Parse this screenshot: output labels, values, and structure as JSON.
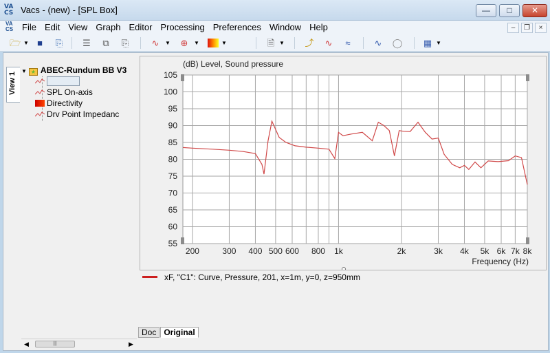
{
  "window": {
    "title": "Vacs - (new) - [SPL Box]",
    "app_icon": [
      "VA",
      "CS"
    ],
    "controls": [
      "minimize",
      "maximize",
      "close"
    ]
  },
  "menubar": {
    "items": [
      "File",
      "Edit",
      "View",
      "Graph",
      "Editor",
      "Processing",
      "Preferences",
      "Window",
      "Help"
    ],
    "mdi_controls": [
      "minimize",
      "restore",
      "close"
    ]
  },
  "toolbar": {
    "icons": [
      "open-folder-icon",
      "save-icon",
      "print-icon",
      "tree-icon",
      "copy-doc-icon",
      "paste-doc-icon",
      "curve-icon",
      "target-icon",
      "colormap-icon",
      "new-doc-icon",
      "load-icon",
      "plot-add-icon",
      "plot-multi-icon",
      "graph-export-icon",
      "disc-icon",
      "calendar-grid-icon"
    ]
  },
  "sidebar": {
    "tab_label": "View 1",
    "root": "ABEC-Rundum BB V3",
    "items": [
      {
        "label": "",
        "icon": "curve-icon",
        "selected": true
      },
      {
        "label": "SPL On-axis",
        "icon": "curve-icon"
      },
      {
        "label": "Directivity",
        "icon": "colormap-icon"
      },
      {
        "label": "Drv Point Impedanc",
        "icon": "curve-icon"
      }
    ]
  },
  "chart_data": {
    "type": "line",
    "title": "(dB)  Level, Sound pressure",
    "xlabel": "Frequency  (Hz)",
    "ylabel": "",
    "xscale": "log",
    "xlim": [
      180,
      8000
    ],
    "ylim": [
      55,
      105
    ],
    "yticks": [
      55,
      60,
      65,
      70,
      75,
      80,
      85,
      90,
      95,
      100,
      105
    ],
    "xtick_labels": [
      {
        "v": 200,
        "t": "200"
      },
      {
        "v": 300,
        "t": "300"
      },
      {
        "v": 400,
        "t": "400"
      },
      {
        "v": 500,
        "t": "500"
      },
      {
        "v": 600,
        "t": "600"
      },
      {
        "v": 800,
        "t": "800"
      },
      {
        "v": 1000,
        "t": "1k"
      },
      {
        "v": 2000,
        "t": "2k"
      },
      {
        "v": 3000,
        "t": "3k"
      },
      {
        "v": 4000,
        "t": "4k"
      },
      {
        "v": 5000,
        "t": "5k"
      },
      {
        "v": 6000,
        "t": "6k"
      },
      {
        "v": 7000,
        "t": "7k"
      },
      {
        "v": 8000,
        "t": "8k"
      }
    ],
    "grid": true,
    "series": [
      {
        "color": "#d04848",
        "x": [
          180,
          200,
          250,
          300,
          350,
          400,
          430,
          440,
          460,
          480,
          520,
          560,
          620,
          700,
          800,
          900,
          960,
          1000,
          1050,
          1150,
          1300,
          1450,
          1550,
          1650,
          1750,
          1850,
          1950,
          2050,
          2200,
          2400,
          2600,
          2800,
          3000,
          3200,
          3500,
          3800,
          4000,
          4200,
          4500,
          4800,
          5200,
          5800,
          6500,
          7000,
          7500,
          8000
        ],
        "values": [
          83.5,
          83.3,
          83,
          82.7,
          82.3,
          81.7,
          78.5,
          75.6,
          85.5,
          91.3,
          86.5,
          85,
          84,
          83.6,
          83.3,
          83,
          80.2,
          88,
          87,
          87.5,
          88,
          85.5,
          91,
          90,
          88.5,
          81,
          88.5,
          88.3,
          88.2,
          91,
          88,
          86,
          86.3,
          81.5,
          78.5,
          77.5,
          78.2,
          77,
          79.2,
          77.5,
          79.5,
          79.3,
          79.6,
          81,
          80.5,
          72.5
        ]
      }
    ]
  },
  "legend": {
    "text": "xF, \"C1\": Curve, Pressure, 201, x=1m, y=0, z=950mm",
    "color": "#cc1f1f"
  },
  "bottom_tabs": [
    {
      "label": "Doc",
      "active": false
    },
    {
      "label": "Original",
      "active": true
    }
  ]
}
